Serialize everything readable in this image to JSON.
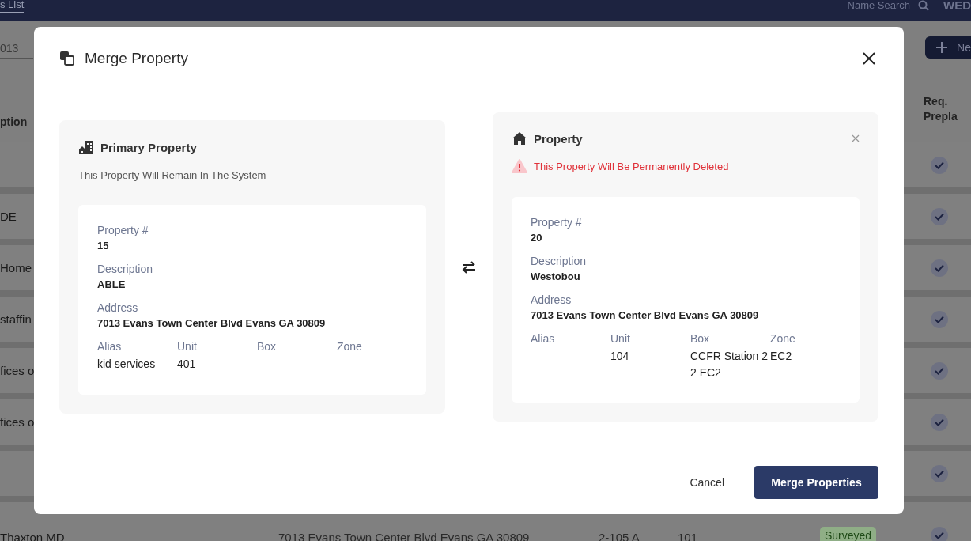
{
  "nav": {
    "tab_label": "s List",
    "search_label": "Name Search",
    "user": "WED"
  },
  "toolbar": {
    "filter_value": "013",
    "new_button": "Ne"
  },
  "table": {
    "columns": [
      "ption",
      "Req. Prepla"
    ],
    "rows": [
      {
        "column_1": "",
        "checked": true
      },
      {
        "column_1": "DE",
        "checked": true
      },
      {
        "column_1": "Home",
        "checked": true
      },
      {
        "column_1": "staffin",
        "checked": true
      },
      {
        "column_1": "fices o",
        "checked": true
      },
      {
        "column_1": "fices o",
        "checked": true
      },
      {
        "column_1": "",
        "checked": true
      },
      {
        "column_1": "Thaxton MD",
        "address": "7013 Evans Town Center Blvd Evans GA 30809",
        "column_3": "2-105 A",
        "column_4": "101",
        "status": "Surveyed",
        "checked": true
      }
    ]
  },
  "modal": {
    "title": "Merge Property",
    "primary": {
      "title": "Primary Property",
      "subtitle": "This Property Will Remain In The System",
      "details": [
        {
          "label": "Property #",
          "value": "15"
        },
        {
          "label": "Description",
          "value": "ABLE"
        },
        {
          "label": "Address",
          "value": "7013 Evans Town Center Blvd Evans GA 30809"
        }
      ],
      "attributes": [
        {
          "label": "Alias",
          "value": "kid services"
        },
        {
          "label": "Unit",
          "value": "401"
        },
        {
          "label": "Box"
        },
        {
          "label": "Zone"
        }
      ]
    },
    "secondary": {
      "title": "Property",
      "warning": "This Property Will Be Permanently Deleted",
      "details": [
        {
          "label": "Property #",
          "value": "20"
        },
        {
          "label": "Description",
          "value": "Westobou"
        },
        {
          "label": "Address",
          "value": "7013 Evans Town Center Blvd Evans GA 30809"
        }
      ],
      "attributes": [
        {
          "label": "Alias"
        },
        {
          "label": "Unit",
          "value": "104"
        },
        {
          "label": "Box",
          "value": "CCFR Station 2 2 EC2"
        },
        {
          "label": "Zone",
          "value": "EC2"
        }
      ]
    },
    "buttons": [
      {
        "label": "Cancel",
        "kind": "text"
      },
      {
        "label": "Merge Properties",
        "kind": "primary"
      }
    ]
  }
}
